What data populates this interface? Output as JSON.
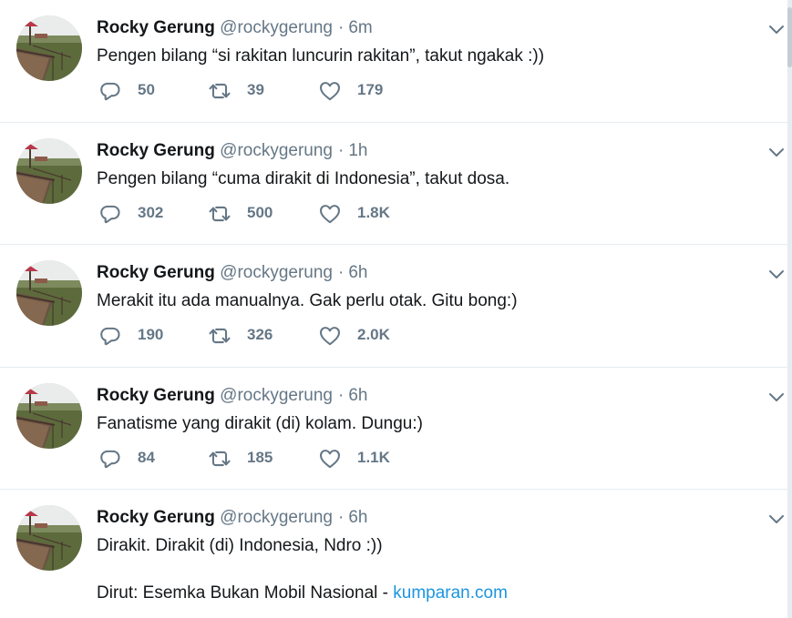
{
  "tweets": [
    {
      "author": "Rocky Gerung",
      "handle": "@rockygerung",
      "separator": "·",
      "time": "6m",
      "text": "Pengen bilang “si rakitan luncurin rakitan”, takut ngakak :))",
      "replies": "50",
      "retweets": "39",
      "likes": "179"
    },
    {
      "author": "Rocky Gerung",
      "handle": "@rockygerung",
      "separator": "·",
      "time": "1h",
      "text": "Pengen bilang “cuma dirakit di Indonesia”, takut dosa.",
      "replies": "302",
      "retweets": "500",
      "likes": "1.8K"
    },
    {
      "author": "Rocky Gerung",
      "handle": "@rockygerung",
      "separator": "·",
      "time": "6h",
      "text": "Merakit itu ada manualnya. Gak perlu otak. Gitu bong:)",
      "replies": "190",
      "retweets": "326",
      "likes": "2.0K"
    },
    {
      "author": "Rocky Gerung",
      "handle": "@rockygerung",
      "separator": "·",
      "time": "6h",
      "text": "Fanatisme yang dirakit (di) kolam. Dungu:)",
      "replies": "84",
      "retweets": "185",
      "likes": "1.1K"
    },
    {
      "author": "Rocky Gerung",
      "handle": "@rockygerung",
      "separator": "·",
      "time": "6h",
      "text": "Dirakit. Dirakit (di) Indonesia, Ndro :))",
      "text_line2": "Dirut: Esemka Bukan Mobil Nasional - ",
      "link": "kumparan.com"
    }
  ],
  "icons": {
    "reply": "reply-icon",
    "retweet": "retweet-icon",
    "like": "heart-icon",
    "menu": "chevron-down-icon",
    "avatar": "avatar"
  },
  "colors": {
    "name": "#14171a",
    "secondary": "#657786",
    "link": "#1b95e0",
    "divider": "#e6ecf0"
  }
}
